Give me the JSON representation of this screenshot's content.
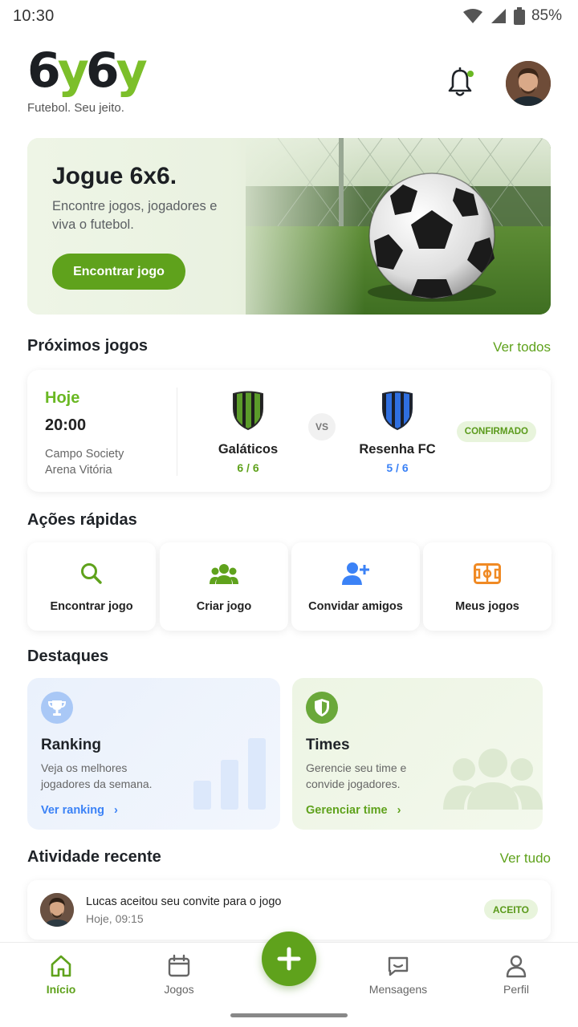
{
  "status_bar": {
    "time": "10:30",
    "battery": "85%"
  },
  "header": {
    "logo": {
      "part1": "6",
      "part2": "y",
      "part3": "6",
      "part4": "y"
    },
    "tagline": "Futebol. Seu jeito.",
    "notification_dot": true
  },
  "hero": {
    "title": "Jogue 6x6.",
    "subtitle": "Encontre jogos, jogadores e viva o futebol.",
    "button": "Encontrar jogo"
  },
  "upcoming": {
    "title": "Próximos jogos",
    "link": "Ver todos",
    "match": {
      "when": "Hoje",
      "time": "20:00",
      "venue_line1": "Campo Society",
      "venue_line2": "Arena Vitória",
      "vs": "VS",
      "status": "CONFIRMADO",
      "home": {
        "name": "Galáticos",
        "count": "6 / 6",
        "color": "#5fa21c",
        "shield": "green-black-stripes"
      },
      "away": {
        "name": "Resenha FC",
        "count": "5 / 6",
        "color": "#3b82f6",
        "shield": "blue-black-stripes"
      }
    }
  },
  "quick_actions": {
    "title": "Ações rápidas",
    "items": [
      {
        "label": "Encontrar jogo",
        "icon": "search-icon",
        "color": "#5fa21c"
      },
      {
        "label": "Criar jogo",
        "icon": "group-icon",
        "color": "#5fa21c"
      },
      {
        "label": "Convidar amigos",
        "icon": "add-user-icon",
        "color": "#3b82f6"
      },
      {
        "label": "Meus jogos",
        "icon": "field-icon",
        "color": "#f08a24"
      }
    ]
  },
  "highlights": {
    "title": "Destaques",
    "ranking": {
      "title": "Ranking",
      "desc": "Veja os melhores jogadores da semana.",
      "link": "Ver ranking",
      "color": "#3b82f6",
      "icon": "trophy-icon"
    },
    "teams": {
      "title": "Times",
      "desc": "Gerencie seu time e convide jogadores.",
      "link": "Gerenciar time",
      "color": "#5fa21c",
      "icon": "shield-icon"
    }
  },
  "activity": {
    "title": "Atividade recente",
    "link": "Ver tudo",
    "item": {
      "text": "Lucas aceitou seu convite para o jogo",
      "time": "Hoje, 09:15",
      "status": "ACEITO"
    }
  },
  "bottom_nav": {
    "items": [
      {
        "label": "Início",
        "icon": "home-icon",
        "active": true
      },
      {
        "label": "Jogos",
        "icon": "calendar-icon",
        "active": false
      },
      {
        "label": "Mensagens",
        "icon": "message-icon",
        "active": false
      },
      {
        "label": "Perfil",
        "icon": "profile-icon",
        "active": false
      }
    ],
    "fab_icon": "plus-icon"
  }
}
